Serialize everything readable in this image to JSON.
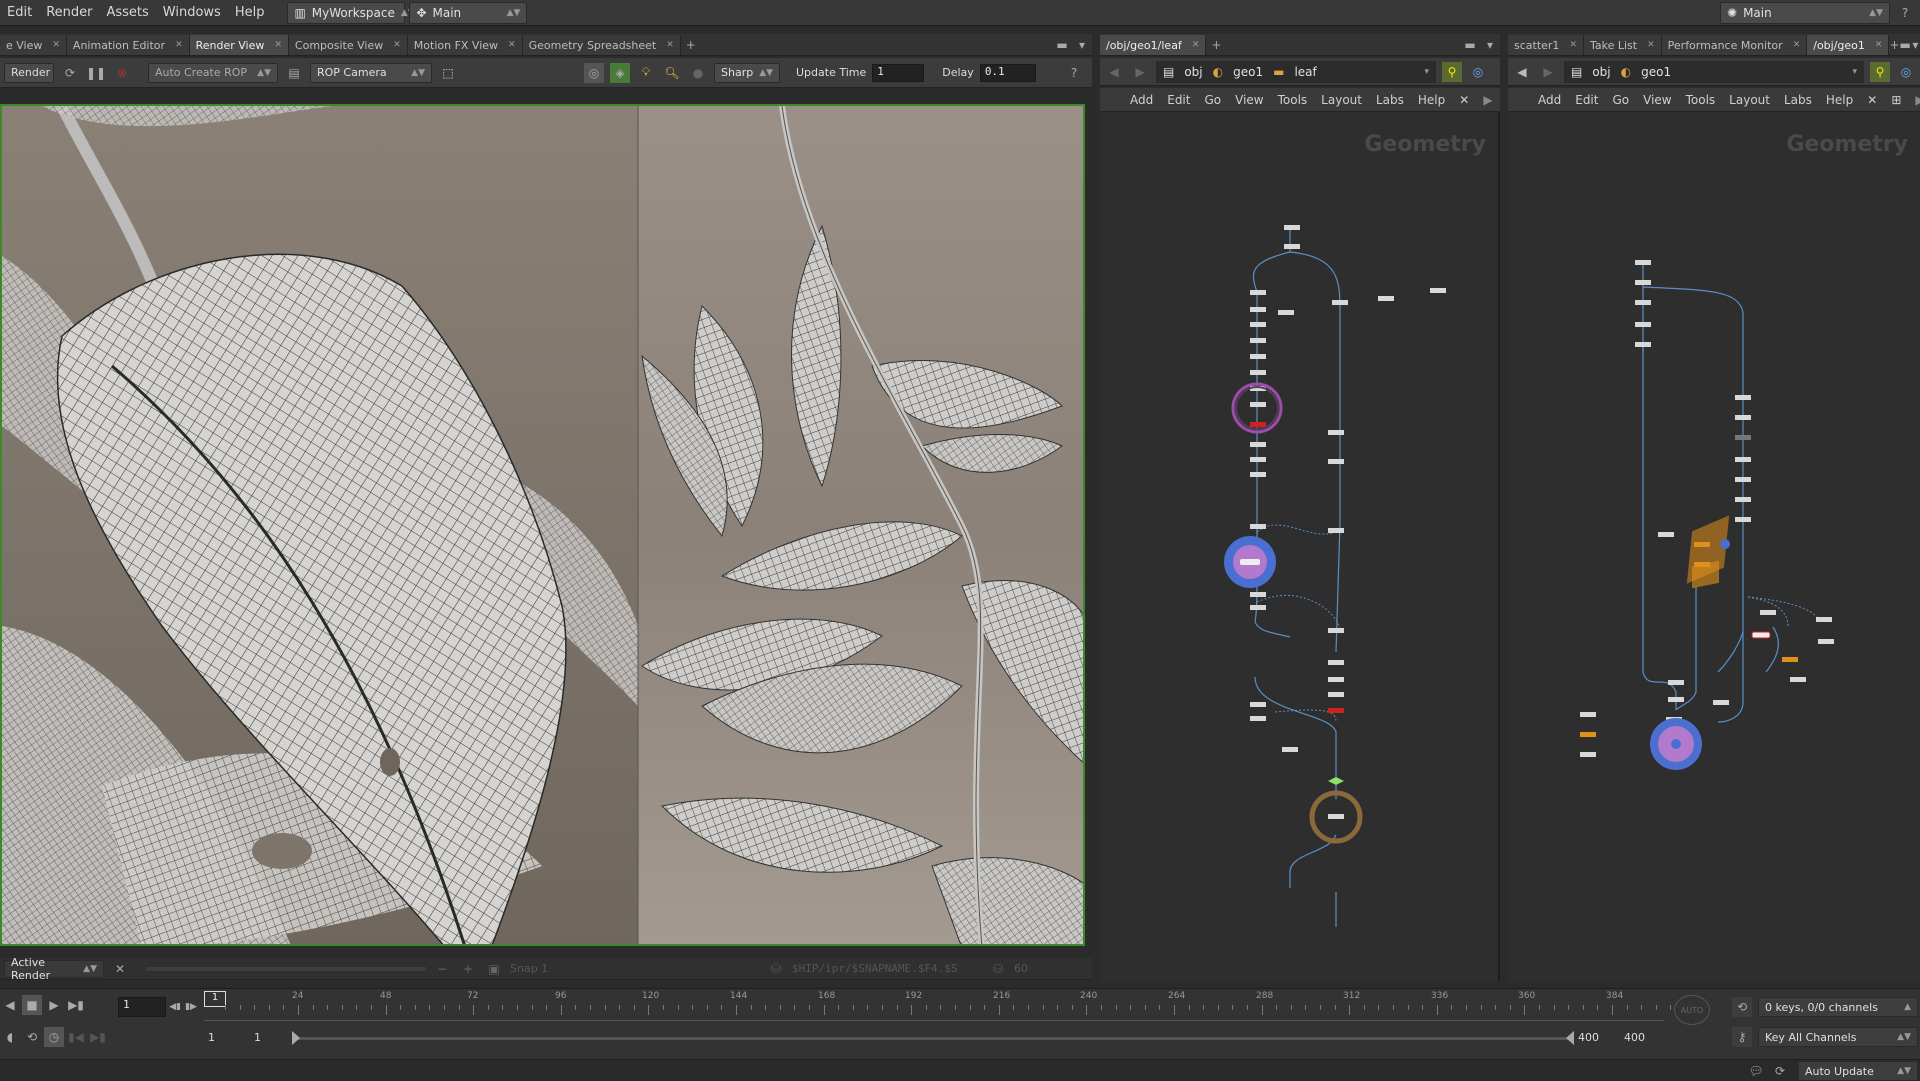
{
  "menubar": {
    "items": [
      "Edit",
      "Render",
      "Assets",
      "Windows",
      "Help"
    ],
    "desktop": "MyWorkspace",
    "context": "Main",
    "right_context": "Main",
    "help_glyph": "?"
  },
  "left_pane": {
    "tabs": [
      {
        "label": "e View",
        "active": false
      },
      {
        "label": "Animation Editor",
        "active": false
      },
      {
        "label": "Render View",
        "active": true
      },
      {
        "label": "Composite View",
        "active": false
      },
      {
        "label": "Motion FX View",
        "active": false
      },
      {
        "label": "Geometry Spreadsheet",
        "active": false
      }
    ],
    "toolbar": {
      "render_button": "Render",
      "auto_create_rop": "Auto Create ROP",
      "camera": "ROP Camera",
      "sharp": "Sharp",
      "update_time_label": "Update Time",
      "update_time_value": "1",
      "delay_label": "Delay",
      "delay_value": "0.1"
    },
    "status": {
      "active_render": "Active Render",
      "snap": "Snap 1",
      "output_path": "$HIP/ipr/$SNAPNAME.$F4.$S",
      "frames": "60"
    }
  },
  "middle_pane": {
    "tab": "/obj/geo1/leaf",
    "path": [
      "obj",
      "geo1",
      "leaf"
    ],
    "menu": [
      "Add",
      "Edit",
      "Go",
      "View",
      "Tools",
      "Layout",
      "Labs",
      "Help"
    ],
    "context_label": "Geometry"
  },
  "right_pane": {
    "tabs": [
      {
        "label": "scatter1",
        "active": false
      },
      {
        "label": "Take List",
        "active": false
      },
      {
        "label": "Performance Monitor",
        "active": false
      },
      {
        "label": "/obj/geo1",
        "active": true
      }
    ],
    "path": [
      "obj",
      "geo1"
    ],
    "menu": [
      "Add",
      "Edit",
      "Go",
      "View",
      "Tools",
      "Layout",
      "Labs",
      "Help"
    ],
    "context_label": "Geometry"
  },
  "timeline": {
    "current_frame": "1",
    "ticks": [
      "24",
      "48",
      "72",
      "96",
      "120",
      "144",
      "168",
      "192",
      "216",
      "240",
      "264",
      "288",
      "312",
      "336",
      "360",
      "384"
    ],
    "range_start": "1",
    "range_start2": "1",
    "range_end": "400",
    "range_end2": "400",
    "keys_info": "0 keys, 0/0 channels",
    "key_all": "Key All Channels",
    "marker": "1"
  },
  "statusbar": {
    "auto_update": "Auto Update"
  },
  "colors": {
    "accent_green": "#3a8a2a",
    "node_purple": "#9b4fa8",
    "node_blue": "#4a6fd0",
    "node_orange": "#e0901a",
    "node_red": "#d02020",
    "wire_blue": "#5b8fc4"
  }
}
